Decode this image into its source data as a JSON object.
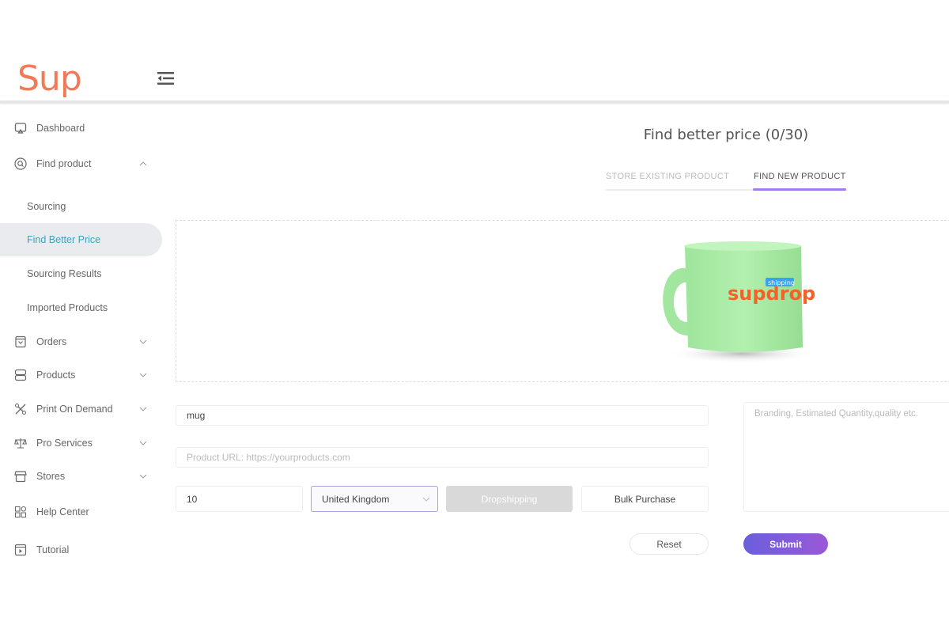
{
  "header": {
    "logo": "Sup",
    "menu_icon": "menu-collapse-icon"
  },
  "sidebar": {
    "items": [
      {
        "label": "Dashboard",
        "icon": "monitor-icon"
      },
      {
        "label": "Find product",
        "icon": "search-circle-icon",
        "expanded": true
      },
      {
        "label": "Sourcing"
      },
      {
        "label": "Find Better Price",
        "active": true
      },
      {
        "label": "Sourcing Results"
      },
      {
        "label": "Imported Products"
      },
      {
        "label": "Orders",
        "icon": "bag-icon"
      },
      {
        "label": "Products",
        "icon": "stack-icon"
      },
      {
        "label": "Print On Demand",
        "icon": "design-tools-icon"
      },
      {
        "label": "Pro Services",
        "icon": "scale-icon"
      },
      {
        "label": "Stores",
        "icon": "store-icon"
      },
      {
        "label": "Help Center",
        "icon": "grid-icon"
      },
      {
        "label": "Tutorial",
        "icon": "video-icon"
      }
    ]
  },
  "main": {
    "title": "Find better price (0/30)",
    "tabs": [
      {
        "label": "STORE EXISTING PRODUCT"
      },
      {
        "label": "FIND NEW PRODUCT",
        "active": true
      }
    ],
    "product_image": {
      "logo_text": "supdrop",
      "logo_sub": "shipping"
    },
    "form": {
      "keyword_value": "mug",
      "url_placeholder": "Product URL: https://yourproducts.com",
      "quantity_value": "10",
      "country_value": "United Kingdom",
      "dropshipping_label": "Dropshipping",
      "bulk_label": "Bulk Purchase",
      "notes_placeholder": "Branding, Estimated Quantity,quality etc.",
      "reset_label": "Reset",
      "submit_label": "Submit"
    }
  },
  "colors": {
    "brand": "#f07b58",
    "accent": "#7b5fe0",
    "active_text": "#3ba3bd",
    "tab_underline": "#a77bf0"
  }
}
